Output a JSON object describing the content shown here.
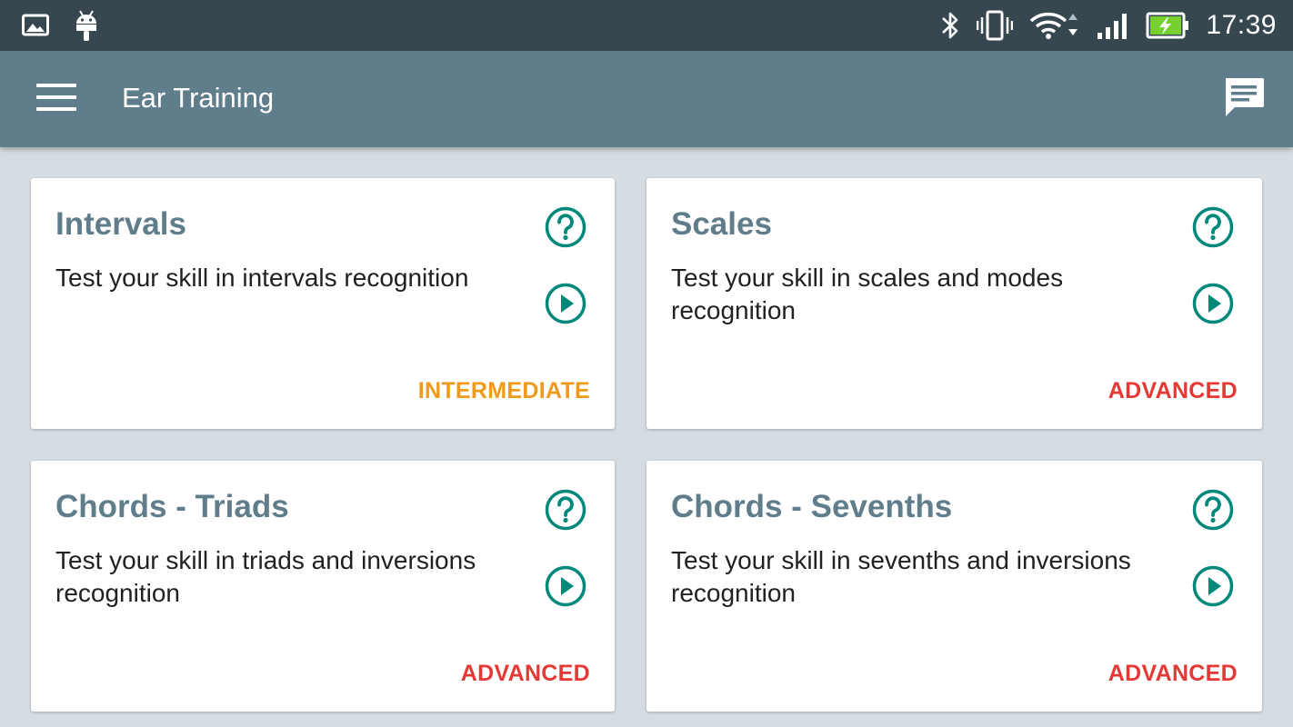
{
  "status_bar": {
    "time": "17:39",
    "left_icons": [
      "image-icon",
      "android-icon"
    ],
    "right_icons": [
      "bluetooth-icon",
      "vibrate-icon",
      "wifi-icon",
      "signal-icon",
      "battery-charging-icon"
    ]
  },
  "app_bar": {
    "title": "Ear Training",
    "menu_icon": "hamburger-menu-icon",
    "action_icon": "feedback-icon"
  },
  "colors": {
    "status_bar": "#37474f",
    "app_bar": "#607d8b",
    "background": "#d6dde2",
    "accent_teal": "#00897b",
    "intermediate": "#ef9a1a",
    "advanced": "#e53935",
    "card_title": "#607d8b"
  },
  "cards": [
    {
      "title": "Intervals",
      "description": "Test your skill in intervals recognition",
      "level": "INTERMEDIATE",
      "level_color": "#ef9a1a"
    },
    {
      "title": "Scales",
      "description": "Test your skill in scales and modes recognition",
      "level": "ADVANCED",
      "level_color": "#e53935"
    },
    {
      "title": "Chords - Triads",
      "description": "Test your skill in triads and inversions recognition",
      "level": "ADVANCED",
      "level_color": "#e53935"
    },
    {
      "title": "Chords - Sevenths",
      "description": "Test your skill in sevenths and inversions recognition",
      "level": "ADVANCED",
      "level_color": "#e53935"
    }
  ]
}
